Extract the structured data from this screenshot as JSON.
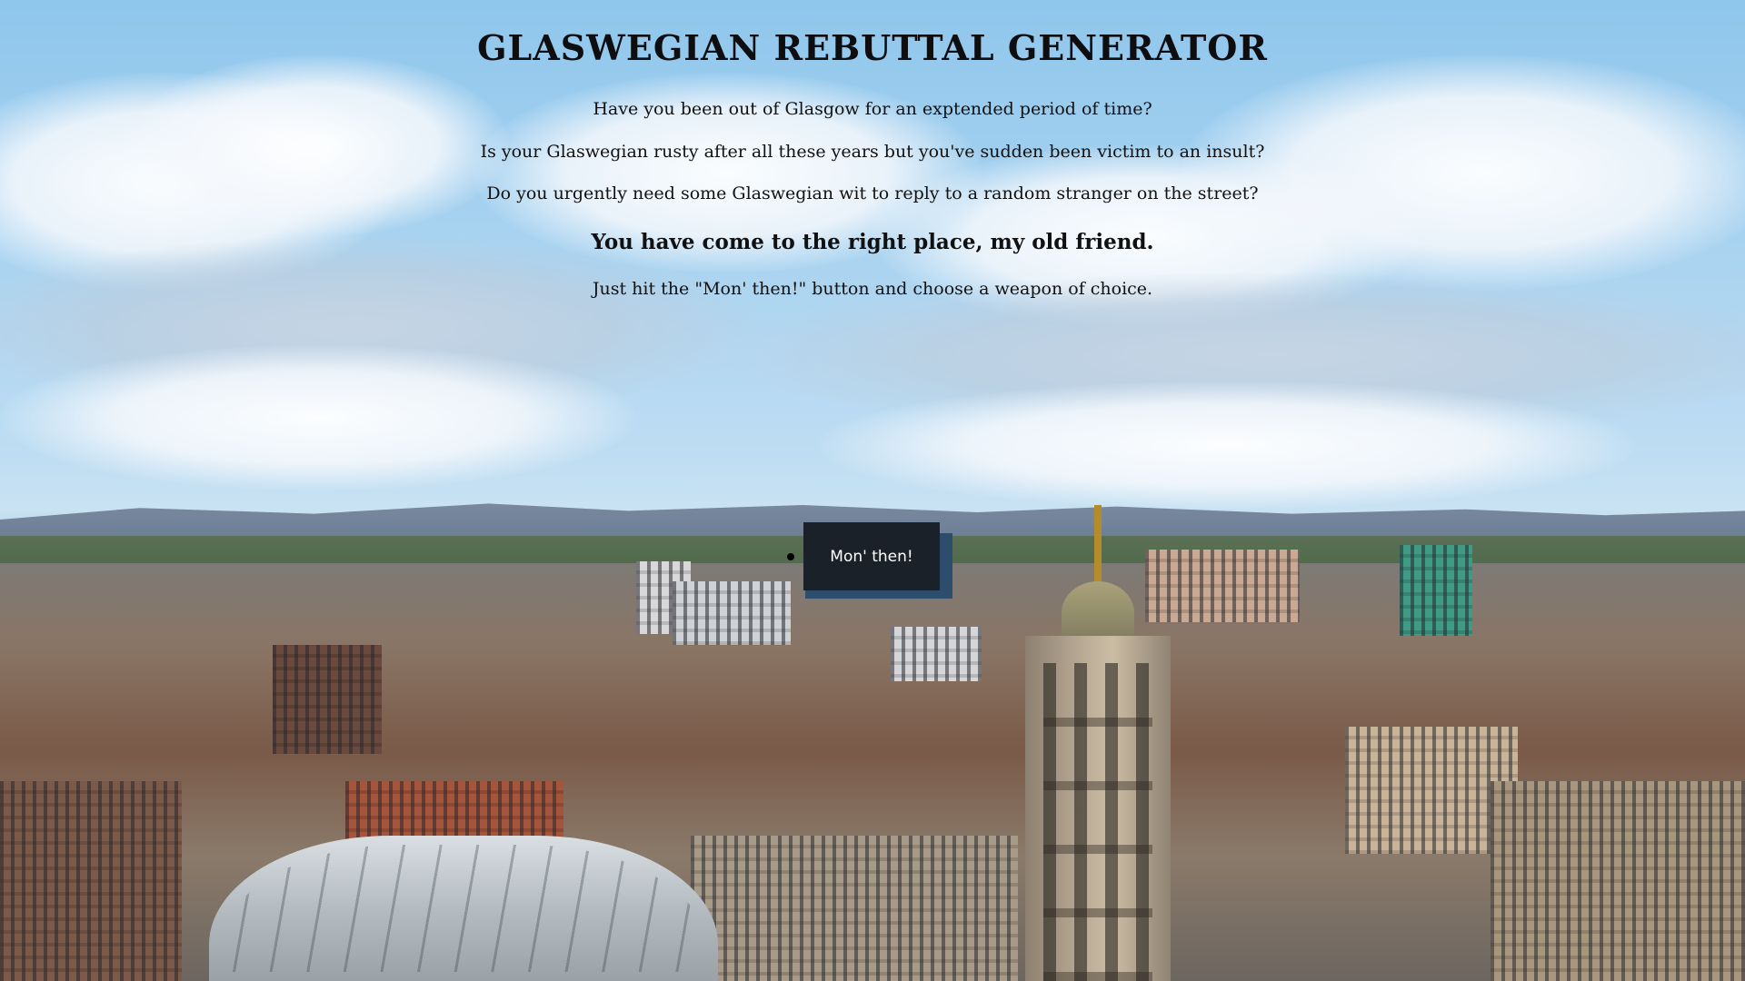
{
  "page": {
    "title": "GLASWEGIAN REBUTTAL GENERATOR",
    "intro_lines": [
      "Have you been out of Glasgow for an exptended period of time?",
      "Is your Glaswegian rusty after all these years but you've sudden been victim to an insult?",
      "Do you urgently need some Glaswegian wit to reply to a random stranger on the street?"
    ],
    "highlight": "You have come to the right place, my old friend.",
    "instruction": "Just hit the \"Mon' then!\" button and choose a weapon of choice."
  },
  "button": {
    "label": "Mon' then!"
  },
  "colors": {
    "button_bg": "#1a2128",
    "button_shadow": "#2c4e6c",
    "sky": "#a9d3f0"
  }
}
